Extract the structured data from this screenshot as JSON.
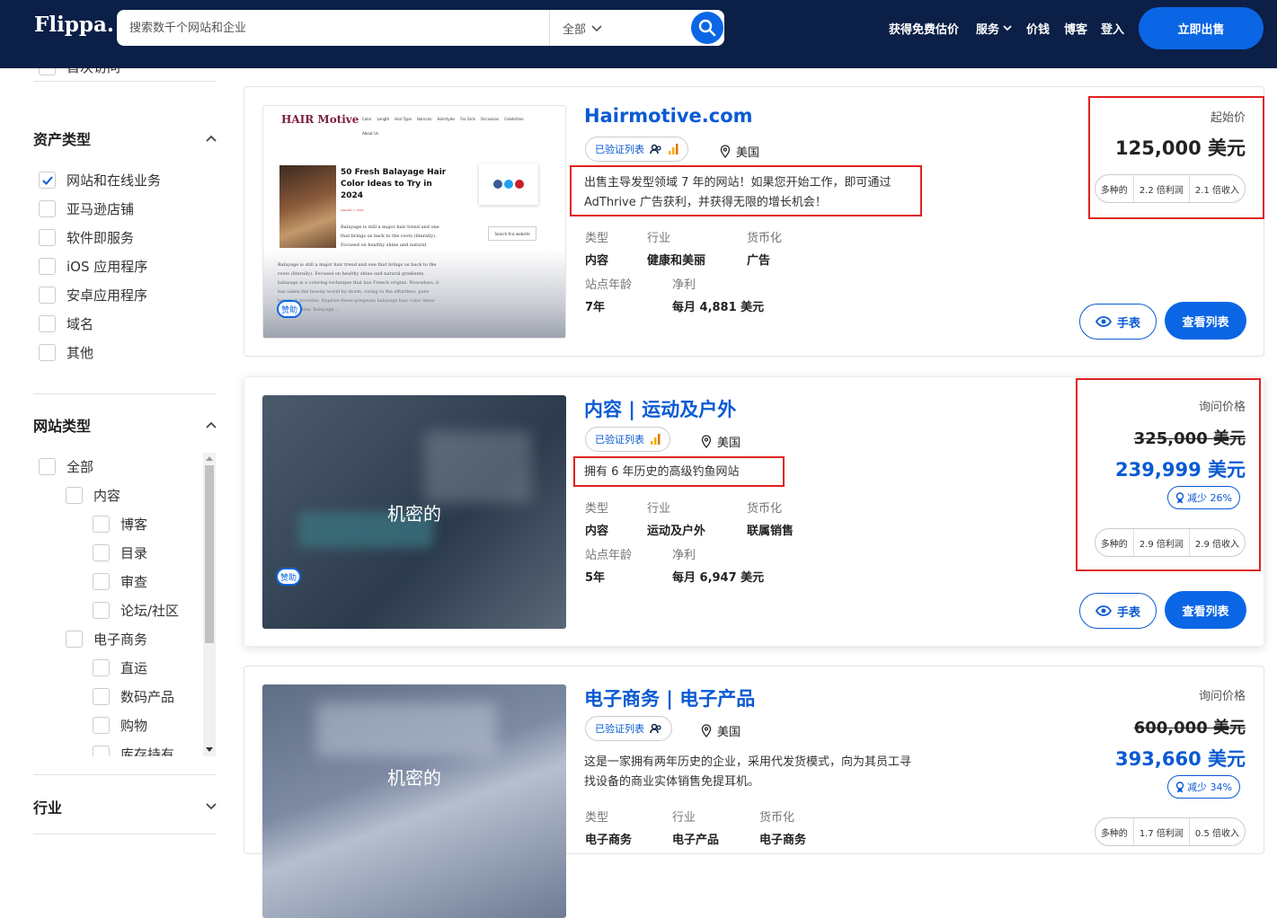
{
  "header": {
    "logo": "Flippa.",
    "search_placeholder": "搜索数千个网站和企业",
    "scope": "全部",
    "nav": [
      "获得免费估价",
      "服务",
      "价钱",
      "博客",
      "登入"
    ],
    "sell_button": "立即出售"
  },
  "sidebar": {
    "cut_label": "首次访问",
    "asset_heading": "资产类型",
    "asset_types": [
      {
        "label": "网站和在线业务",
        "checked": true
      },
      {
        "label": "亚马逊店铺",
        "checked": false
      },
      {
        "label": "软件即服务",
        "checked": false
      },
      {
        "label": "iOS 应用程序",
        "checked": false
      },
      {
        "label": "安卓应用程序",
        "checked": false
      },
      {
        "label": "域名",
        "checked": false
      },
      {
        "label": "其他",
        "checked": false
      }
    ],
    "site_heading": "网站类型",
    "site_types": [
      {
        "label": "全部",
        "level": 0
      },
      {
        "label": "内容",
        "level": 1
      },
      {
        "label": "博客",
        "level": 2
      },
      {
        "label": "目录",
        "level": 2
      },
      {
        "label": "审查",
        "level": 2
      },
      {
        "label": "论坛/社区",
        "level": 2
      },
      {
        "label": "电子商务",
        "level": 1
      },
      {
        "label": "直运",
        "level": 2
      },
      {
        "label": "数码产品",
        "level": 2
      },
      {
        "label": "购物",
        "level": 2
      },
      {
        "label": "库存持有",
        "level": 2
      }
    ],
    "industry_heading": "行业"
  },
  "labels": {
    "type": "类型",
    "industry": "行业",
    "monetization": "货币化",
    "age": "站点年龄",
    "profit": "净利",
    "watch": "手表",
    "view": "查看列表",
    "verified": "已验证列表",
    "confidential": "机密的",
    "sponsored": "赞助"
  },
  "listings": [
    {
      "title": "Hairmotive.com",
      "location": "美国",
      "description": [
        "出售主导发型领域 7 年的网站！如果您开始工作，即可通过",
        "AdThrive 广告获利，并获得无限的增长机会！"
      ],
      "type": "内容",
      "industry": "健康和美丽",
      "monetization": "广告",
      "age": "7年",
      "profit": "每月 4,881 美元",
      "price_label": "起始价",
      "price": "125,000 美元",
      "multiples": [
        "多种的",
        "2.2 倍利润",
        "2.1 倍收入"
      ],
      "preview": {
        "brand": "HAIR Motive",
        "menu": [
          "Color",
          "Length",
          "Hair Type",
          "Haircuts",
          "Hairstyles",
          "For Girls",
          "Occasions",
          "Celebrities"
        ],
        "about": "About Us",
        "headline": "50 Fresh Balayage Hair Color Ideas to Try in 2024",
        "byline": "JANUARY 1, 2024",
        "body": "Balayage is still a major hair trend and one that brings us back to the roots (literally). Focused on healthy shine and natural gradients, balayage is a coloring technique that has French origins. Nowadays, it has taken the beauty world by storm, owing to the effortless, pure beauty it provides. Explore these gorgeous balayage hair color ideas for inspiration. Balayage ...",
        "search": "Search this website"
      }
    },
    {
      "title": "内容 | 运动及户外",
      "location": "美国",
      "description": [
        "拥有 6 年历史的高级钓鱼网站"
      ],
      "type": "内容",
      "industry": "运动及户外",
      "monetization": "联属销售",
      "age": "5年",
      "profit": "每月 6,947 美元",
      "price_label": "询问价格",
      "old_price": "325,000 美元",
      "price": "239,999 美元",
      "reduction": "减少 26%",
      "multiples": [
        "多种的",
        "2.9 倍利润",
        "2.9 倍收入"
      ]
    },
    {
      "title": "电子商务 | 电子产品",
      "location": "美国",
      "description": [
        "这是一家拥有两年历史的企业，采用代发货模式，向为其员工寻",
        "找设备的商业实体销售免提耳机。"
      ],
      "type": "电子商务",
      "industry": "电子产品",
      "monetization": "电子商务",
      "price_label": "询问价格",
      "old_price": "600,000 美元",
      "price": "393,660 美元",
      "reduction": "减少 34%",
      "multiples": [
        "多种的",
        "1.7 倍利润",
        "0.5 倍收入"
      ]
    }
  ],
  "colors": {
    "header_bg": "#0b1f47",
    "accent": "#0a66e4",
    "link": "#0a5ad4",
    "highlight_box": "#e02020"
  }
}
